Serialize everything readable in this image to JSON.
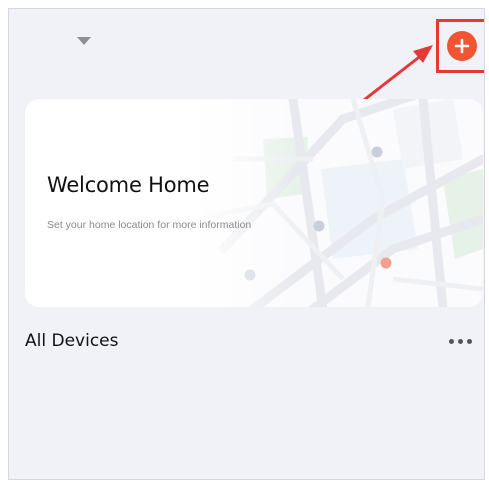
{
  "header": {
    "home_selector_icon": "triangle-down-icon",
    "add_button_icon": "plus-icon",
    "accent_color": "#f25533",
    "annotation_color": "#e53935"
  },
  "welcome_card": {
    "title": "Welcome Home",
    "subtitle": "Set your home location for more information",
    "background_icon": "map-illustration"
  },
  "devices": {
    "title": "All Devices",
    "more_icon": "more-horizontal-icon"
  }
}
